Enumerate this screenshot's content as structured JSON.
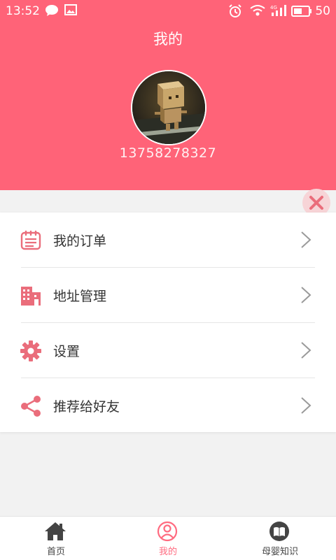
{
  "status_bar": {
    "time": "13:52",
    "battery": "50"
  },
  "header": {
    "title": "我的",
    "phone": "13758278327"
  },
  "menu": {
    "items": [
      {
        "label": "我的订单",
        "icon": "order-list-icon"
      },
      {
        "label": "地址管理",
        "icon": "building-icon"
      },
      {
        "label": "设置",
        "icon": "gear-icon"
      },
      {
        "label": "推荐给好友",
        "icon": "share-icon"
      }
    ]
  },
  "tabs": [
    {
      "label": "首页",
      "icon": "home-icon",
      "active": false
    },
    {
      "label": "我的",
      "icon": "user-icon",
      "active": true
    },
    {
      "label": "母婴知识",
      "icon": "book-icon",
      "active": false
    }
  ],
  "colors": {
    "brand": "#ff6378",
    "accent": "#ff6b80",
    "background": "#f2f2f2"
  }
}
